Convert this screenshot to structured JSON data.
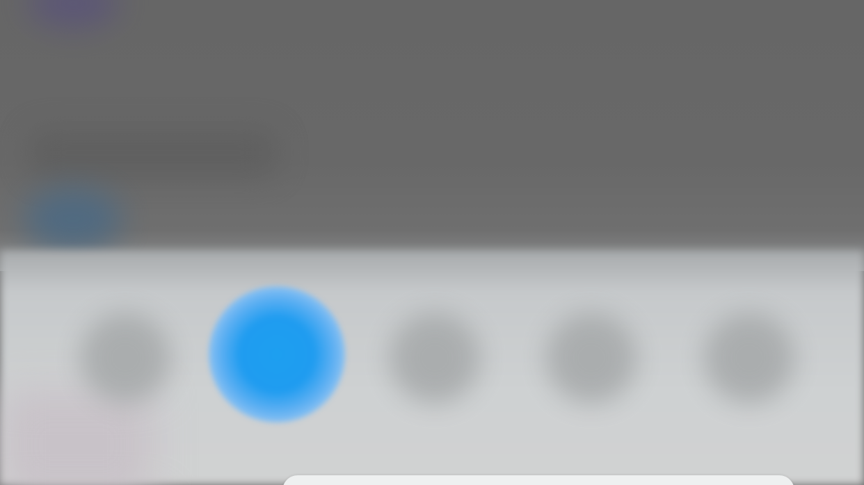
{
  "background": {
    "dim_color": "#676767",
    "panel_color": "#ced1d2"
  },
  "icon_row": {
    "items": [
      {
        "name": "app-icon-1",
        "state": "blurred"
      },
      {
        "name": "app-icon-2",
        "state": "highlighted",
        "color": "#1d9ff0"
      },
      {
        "name": "app-icon-3",
        "state": "blurred"
      },
      {
        "name": "app-icon-4",
        "state": "blurred"
      },
      {
        "name": "app-icon-5",
        "state": "blurred"
      }
    ]
  },
  "bottom_sheet": {
    "color": "#eef0f0"
  }
}
